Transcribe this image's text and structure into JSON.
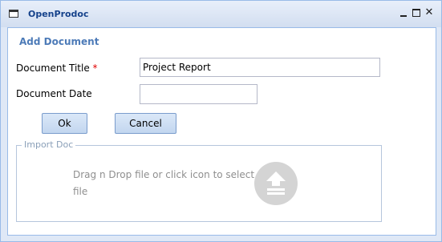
{
  "window": {
    "title": "OpenProdoc"
  },
  "form": {
    "section_title": "Add Document",
    "document_title_label": "Document Title",
    "required_marker": "*",
    "document_title_value": "Project Report",
    "document_date_label": "Document Date",
    "document_date_value": ""
  },
  "buttons": {
    "ok_label": "Ok",
    "cancel_label": "Cancel"
  },
  "import": {
    "legend": "Import Doc",
    "drop_text": "Drag n Drop file or click icon to select file",
    "upload_icon": "upload-arrow-icon"
  },
  "colors": {
    "title_text": "#15428b",
    "section_title": "#4d7bb8",
    "required": "#e00000",
    "drop_hint": "#8f8f8f"
  }
}
